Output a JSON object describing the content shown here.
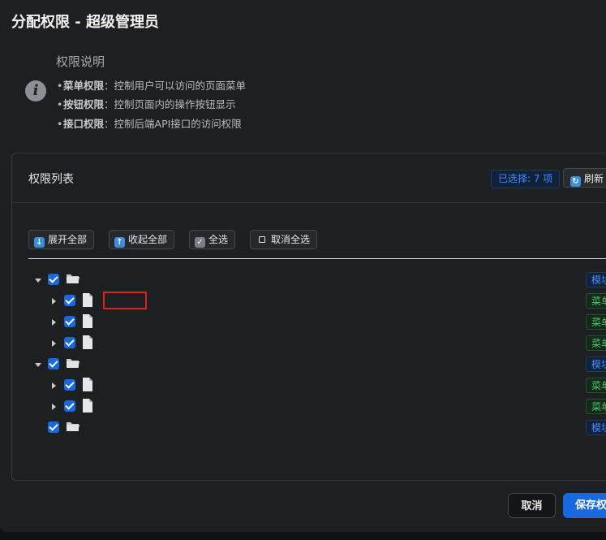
{
  "dialog": {
    "title": "分配权限 - 超级管理员"
  },
  "info": {
    "title": "权限说明",
    "lines": [
      {
        "term": "菜单权限",
        "desc": "：控制用户可以访问的页面菜单"
      },
      {
        "term": "按钮权限",
        "desc": "：控制页面内的操作按钮显示"
      },
      {
        "term": "接口权限",
        "desc": "：控制后端API接口的访问权限"
      }
    ]
  },
  "card": {
    "title": "权限列表",
    "selected_badge": "已选择: 7 项",
    "refresh_label": "刷新"
  },
  "toolbar": {
    "expand_all": "展开全部",
    "collapse_all": "收起全部",
    "select_all": "全选",
    "deselect_all": "取消全选"
  },
  "tree": {
    "rows": [
      {
        "level": 0,
        "expanded": true,
        "icon": "folder-icon",
        "tag": "模块",
        "tag_type": "module",
        "checked": true
      },
      {
        "level": 1,
        "expanded": false,
        "icon": "file-icon",
        "tag": "菜单",
        "tag_type": "menu",
        "checked": true
      },
      {
        "level": 1,
        "expanded": false,
        "icon": "file-icon",
        "tag": "菜单",
        "tag_type": "menu",
        "checked": true
      },
      {
        "level": 1,
        "expanded": false,
        "icon": "file-icon",
        "tag": "菜单",
        "tag_type": "menu",
        "checked": true
      },
      {
        "level": 0,
        "expanded": true,
        "icon": "folder-icon",
        "tag": "模块",
        "tag_type": "module",
        "checked": true
      },
      {
        "level": 1,
        "expanded": false,
        "icon": "file-icon",
        "tag": "菜单",
        "tag_type": "menu",
        "checked": true
      },
      {
        "level": 1,
        "expanded": false,
        "icon": "file-icon",
        "tag": "菜单",
        "tag_type": "menu",
        "checked": true
      },
      {
        "level": 0,
        "expanded": null,
        "icon": "folder-icon",
        "tag": "模块",
        "tag_type": "module",
        "checked": true
      }
    ]
  },
  "footer": {
    "cancel_label": "取消",
    "save_label": "保存权限"
  },
  "colors": {
    "primary": "#1769e0",
    "module_tag": "#3f8cff",
    "menu_tag": "#4cc56a",
    "highlight": "#e0201c"
  }
}
